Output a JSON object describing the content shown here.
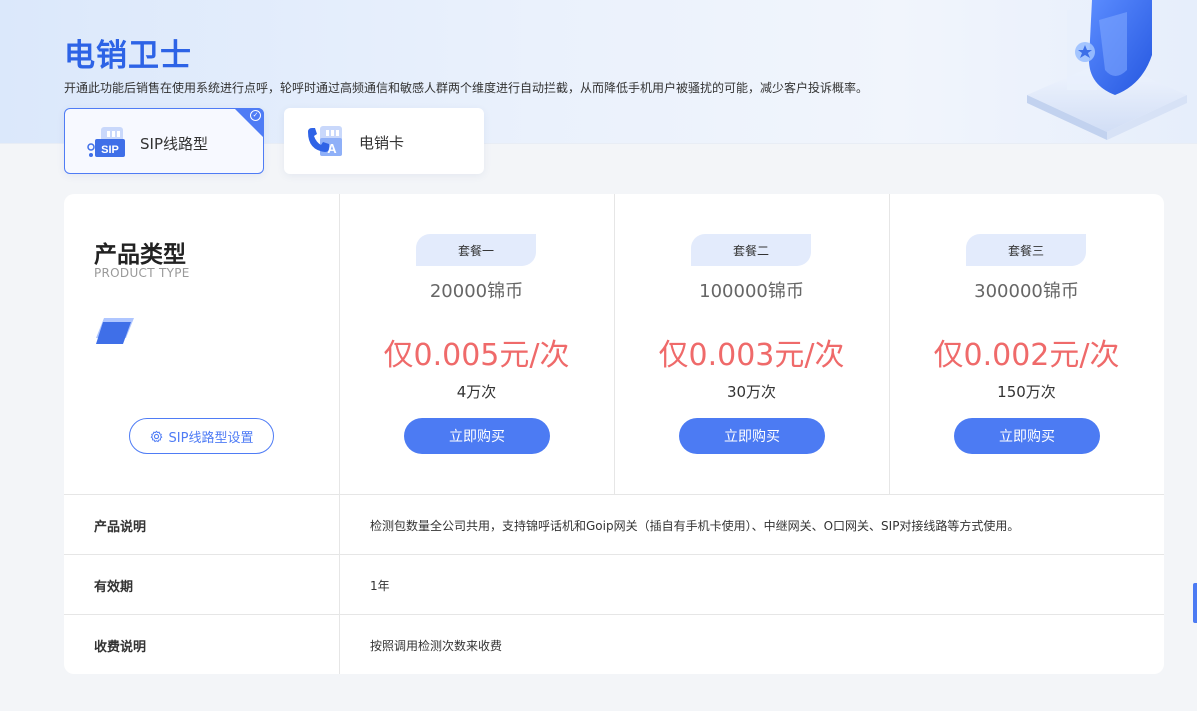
{
  "header": {
    "title": "电销卫士",
    "description": "开通此功能后销售在使用系统进行点呼，轮呼时通过高频通信和敏感人群两个维度进行自动拦截，从而降低手机用户被骚扰的可能，减少客户投诉概率。"
  },
  "tabs": [
    {
      "label": "SIP线路型",
      "icon_text": "SIP",
      "icon": "sip-icon",
      "active": true
    },
    {
      "label": "电销卡",
      "icon_text": "A",
      "icon": "phone-card-icon",
      "active": false
    }
  ],
  "product_type": {
    "title": "产品类型",
    "subtitle": "PRODUCT TYPE",
    "setting_button": "SIP线路型设置"
  },
  "plans": [
    {
      "badge": "套餐一",
      "coins": "20000锦币",
      "price": "仅0.005元/次",
      "times": "4万次",
      "buy_label": "立即购买"
    },
    {
      "badge": "套餐二",
      "coins": "100000锦币",
      "price": "仅0.003元/次",
      "times": "30万次",
      "buy_label": "立即购买"
    },
    {
      "badge": "套餐三",
      "coins": "300000锦币",
      "price": "仅0.002元/次",
      "times": "150万次",
      "buy_label": "立即购买"
    }
  ],
  "info_rows": [
    {
      "label": "产品说明",
      "value": "检测包数量全公司共用，支持锦呼话机和Goip网关（插自有手机卡使用）、中继网关、O口网关、SIP对接线路等方式使用。"
    },
    {
      "label": "有效期",
      "value": "1年"
    },
    {
      "label": "收费说明",
      "value": "按照调用检测次数来收费"
    }
  ],
  "colors": {
    "accent": "#4c7bf3",
    "title_blue": "#2d63e6",
    "price_red": "#ef6a6a",
    "badge_bg": "#e3ebfc"
  }
}
